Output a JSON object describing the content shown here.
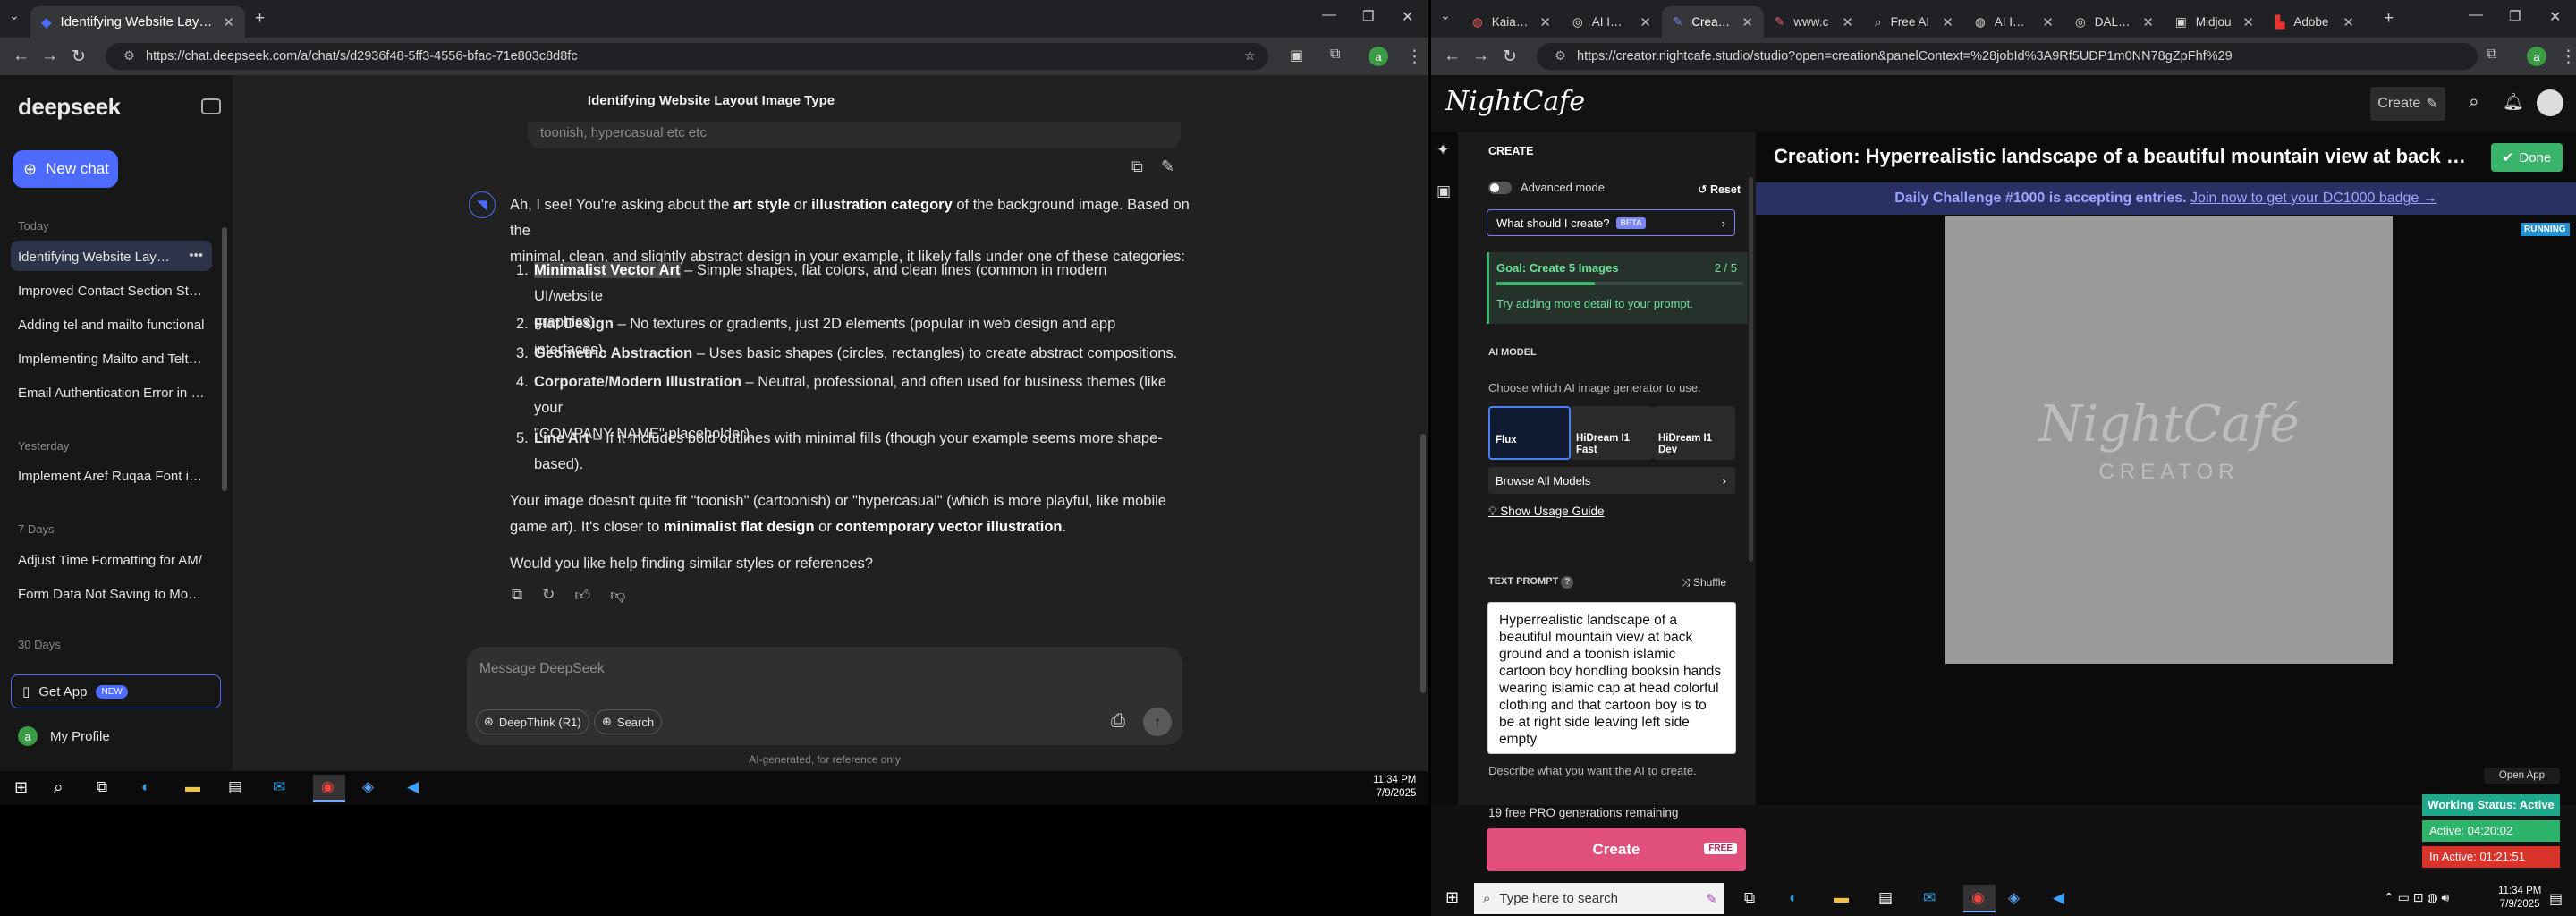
{
  "left_browser": {
    "tab": {
      "title": "Identifying Website Layout Ima"
    },
    "url": "https://chat.deepseek.com/a/chat/s/d2936f48-5ff3-4556-bfac-71e803c8d8fc"
  },
  "deepseek": {
    "logo": "deepseek",
    "new_chat": "New chat",
    "sections": {
      "today": "Today",
      "yesterday": "Yesterday",
      "seven_days": "7 Days",
      "thirty_days": "30 Days"
    },
    "today_items": [
      "Identifying Website Layout",
      "Improved Contact Section Styling",
      "Adding tel and mailto functional",
      "Implementing Mailto and Telto F",
      "Email Authentication Error in No"
    ],
    "yesterday_items": [
      "Implement Aref Ruqaa Font in R"
    ],
    "seven_day_items": [
      "Adjust Time Formatting for AM/",
      "Form Data Not Saving to Mongo"
    ],
    "get_app": "Get App",
    "new_badge": "NEW",
    "profile": "My Profile",
    "chat_title": "Identifying Website Layout Image Type",
    "prev_snippet": "toonish, hypercasual etc etc",
    "reply": {
      "intro_1": "Ah, I see! You're asking about the ",
      "intro_b1": "art style",
      "intro_2": " or ",
      "intro_b2": "illustration category",
      "intro_3": " of the background image. Based on the",
      "intro_line2": "minimal, clean, and slightly abstract design in your example, it likely falls under one of these categories:",
      "items": [
        {
          "n": "1.",
          "title": "Minimalist Vector Art",
          "rest": " – Simple shapes, flat colors, and clean lines (common in modern UI/website",
          "rest2": "graphics)."
        },
        {
          "n": "2.",
          "title": "Flat Design",
          "rest": " – No textures or gradients, just 2D elements (popular in web design and app interfaces).",
          "rest2": ""
        },
        {
          "n": "3.",
          "title": "Geometric Abstraction",
          "rest": " – Uses basic shapes (circles, rectangles) to create abstract compositions.",
          "rest2": ""
        },
        {
          "n": "4.",
          "title": "Corporate/Modern Illustration",
          "rest": " – Neutral, professional, and often used for business themes (like your",
          "rest2": "\"COMPANY NAME\" placeholder)."
        },
        {
          "n": "5.",
          "title": "Line Art",
          "rest": " – If it includes bold outlines with minimal fills (though your example seems more shape-",
          "rest2": "based)."
        }
      ],
      "para2_1": "Your image doesn't quite fit \"toonish\" (cartoonish) or \"hypercasual\" (which is more playful, like mobile",
      "para2_2a": "game art). It's closer to ",
      "para2_b1": "minimalist flat design",
      "para2_2b": " or ",
      "para2_b2": "contemporary vector illustration",
      "para2_2c": ".",
      "para3": "Would you like help finding similar styles or references?"
    },
    "input_placeholder": "Message DeepSeek",
    "deepthink": "DeepThink (R1)",
    "search": "Search",
    "disclaimer": "AI-generated, for reference only"
  },
  "taskbar_left": {
    "time": "11:34 PM",
    "date": "7/9/2025"
  },
  "right_browser": {
    "tabs": [
      "Kaiaams",
      "AI Imag",
      "Creation",
      "www.c",
      "Free AI",
      "AI Imag",
      "DALL-E",
      "Midjou",
      "Adobe"
    ],
    "url": "https://creator.nightcafe.studio/studio?open=creation&panelContext=%28jobId%3A9Rf5UDP1m0NN78gZpFhf%29"
  },
  "nightcafe": {
    "logo": "NightCafe",
    "create_btn": "Create",
    "panel_title": "CREATE",
    "advanced": "Advanced mode",
    "reset": "Reset",
    "what_create": "What should I create?",
    "beta": "BETA",
    "goal": "Goal: Create 5 Images",
    "goal_count": "2 / 5",
    "goal_progress": 0.4,
    "goal_tip": "Try adding more detail to your prompt.",
    "ai_model_label": "AI MODEL",
    "ai_model_desc": "Choose which AI image generator to use.",
    "models": [
      "Flux",
      "HiDream I1 Fast",
      "HiDream I1 Dev"
    ],
    "browse_models": "Browse All Models",
    "usage_guide": "Show Usage Guide",
    "text_prompt_label": "TEXT PROMPT",
    "shuffle": "Shuffle",
    "prompt": "Hyperrealistic landscape of a beautiful mountain view at back ground and a toonish islamic cartoon boy hondling booksin hands wearing islamic cap at head colorful clothing and that cartoon boy is to be at right side leaving left side empty",
    "prompt_hint": "Describe what you want the AI to create.",
    "free_pro": "19 free PRO generations remaining",
    "create_main": "Create",
    "free_tag": "FREE",
    "creation_title": "Creation: Hyperrealistic landscape of a beautiful mountain view at back g...",
    "done": "Done",
    "challenge_text": "Daily Challenge #1000 is accepting entries.",
    "challenge_link": "Join now to get your DC1000 badge →",
    "running": "RUNNING",
    "watermark_top": "NightCafé",
    "watermark_bottom": "CREATOR"
  },
  "status_widget": {
    "open_app": "Open App",
    "working": "Working Status: Active",
    "active": "Active: 04:20:02",
    "inactive": "In Active: 01:21:51"
  },
  "taskbar_right": {
    "search_placeholder": "Type here to search",
    "time": "11:34 PM",
    "date": "7/9/2025"
  },
  "colors": {
    "ds_blue": "#4d6bfe",
    "nc_green": "#3bb46b",
    "nc_accent": "#7b86f5"
  }
}
